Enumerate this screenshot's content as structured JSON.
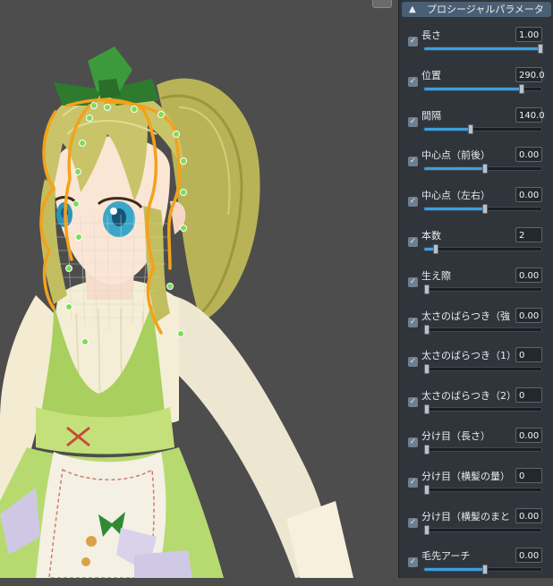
{
  "panel": {
    "title": "プロシージャルパラメータ",
    "collapse_icon": "chevron-up-icon",
    "accent": "#3aa0e0",
    "params": [
      {
        "label": "長さ",
        "value": "1.00",
        "fraction": 1.0,
        "checked": true
      },
      {
        "label": "位置",
        "value": "290.0",
        "fraction": 0.82,
        "checked": true
      },
      {
        "label": "間隔",
        "value": "140.0",
        "fraction": 0.39,
        "checked": true
      },
      {
        "label": "中心点（前後）",
        "value": "0.00",
        "fraction": 0.51,
        "checked": true
      },
      {
        "label": "中心点（左右）",
        "value": "0.00",
        "fraction": 0.51,
        "checked": true
      },
      {
        "label": "本数",
        "value": "2",
        "fraction": 0.1,
        "checked": true
      },
      {
        "label": "生え際",
        "value": "0.00",
        "fraction": 0.0,
        "checked": true
      },
      {
        "label": "太さのばらつき（強",
        "value": "0.00",
        "fraction": 0.0,
        "checked": true
      },
      {
        "label": "太さのばらつき（1）",
        "value": "0",
        "fraction": 0.0,
        "checked": true
      },
      {
        "label": "太さのばらつき（2）",
        "value": "0",
        "fraction": 0.0,
        "checked": true
      },
      {
        "label": "分け目（長さ）",
        "value": "0.00",
        "fraction": 0.0,
        "checked": true
      },
      {
        "label": "分け目（横髪の量）",
        "value": "0",
        "fraction": 0.0,
        "checked": true
      },
      {
        "label": "分け目（横髪のまと",
        "value": "0.00",
        "fraction": 0.0,
        "checked": true
      },
      {
        "label": "毛先アーチ",
        "value": "0.00",
        "fraction": 0.51,
        "checked": true
      }
    ]
  }
}
